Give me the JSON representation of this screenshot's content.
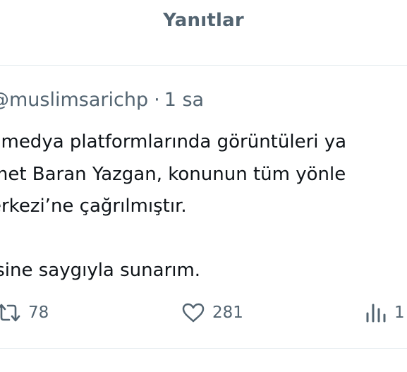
{
  "header": {
    "title": "Yanıtlar"
  },
  "tweet": {
    "handle": "@muslimsarichp",
    "separator": "·",
    "time": "1 sa",
    "lines": [
      "l medya platformlarında görüntüleri ya",
      "met Baran Yazgan, konunun tüm yönle",
      "erkezi’ne çağrılmıştır.",
      "",
      "isine saygıyla sunarım."
    ],
    "actions": {
      "reposts": "78",
      "likes": "281",
      "views": "1"
    }
  },
  "icons": {
    "repost": "repost-icon",
    "like": "heart-icon",
    "views": "analytics-icon"
  },
  "colors": {
    "text": "#0f1419",
    "secondary": "#536471",
    "divider": "#e6ecf0"
  }
}
